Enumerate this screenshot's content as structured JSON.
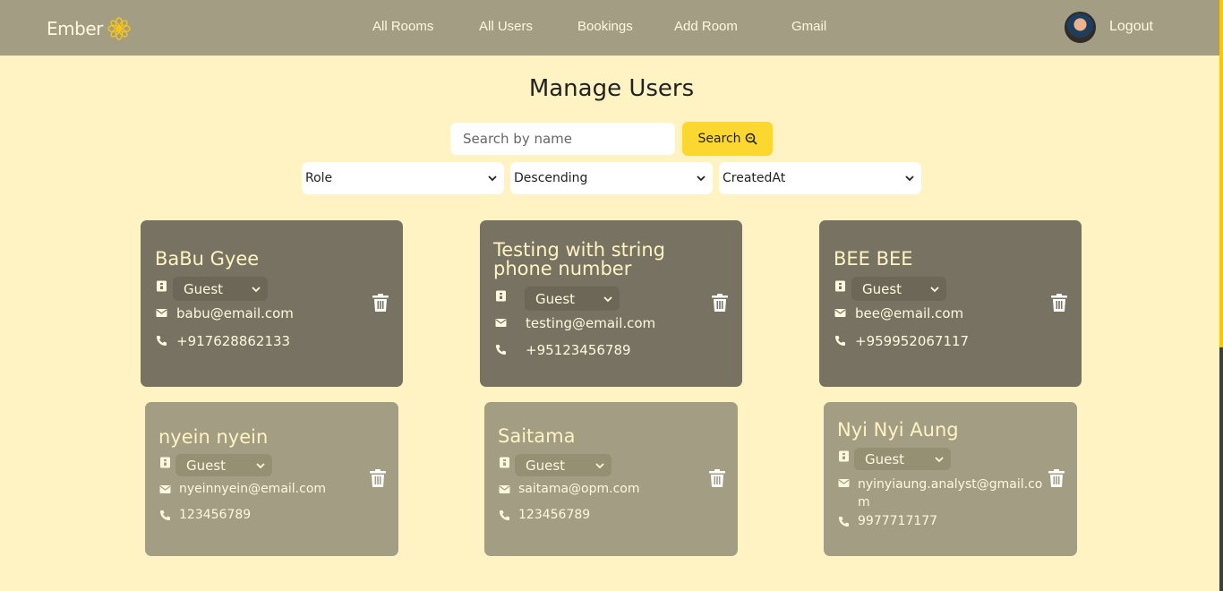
{
  "nav": {
    "brand": "Ember",
    "links": [
      "All Rooms",
      "All Users",
      "Bookings",
      "Add Room",
      "Gmail"
    ],
    "logout": "Logout"
  },
  "page": {
    "title": "Manage Users"
  },
  "search": {
    "placeholder": "Search by name",
    "button": "Search"
  },
  "filters": {
    "role": "Role",
    "order": "Descending",
    "sort_by": "CreatedAt"
  },
  "users": [
    {
      "name": "BaBu Gyee",
      "role": "Guest",
      "email": "babu@email.com",
      "phone": "+917628862133"
    },
    {
      "name": "Testing with string phone number",
      "role": "Guest",
      "email": "testing@email.com",
      "phone": "+95123456789"
    },
    {
      "name": "BEE BEE",
      "role": "Guest",
      "email": "bee@email.com",
      "phone": "+959952067117"
    },
    {
      "name": "nyein nyein",
      "role": "Guest",
      "email": "nyeinnyein@email.com",
      "phone": "123456789"
    },
    {
      "name": "Saitama",
      "role": "Guest",
      "email": "saitama@opm.com",
      "phone": "123456789"
    },
    {
      "name": "Nyi Nyi Aung",
      "role": "Guest",
      "email": "nyinyiaung.analyst@gmail.com",
      "phone": "9977717177"
    }
  ],
  "colors": {
    "navbar": "#a29d83",
    "background": "#fff3c4",
    "accent": "#fbd730",
    "card_dark": "#777261",
    "card_light": "#a29d83"
  }
}
